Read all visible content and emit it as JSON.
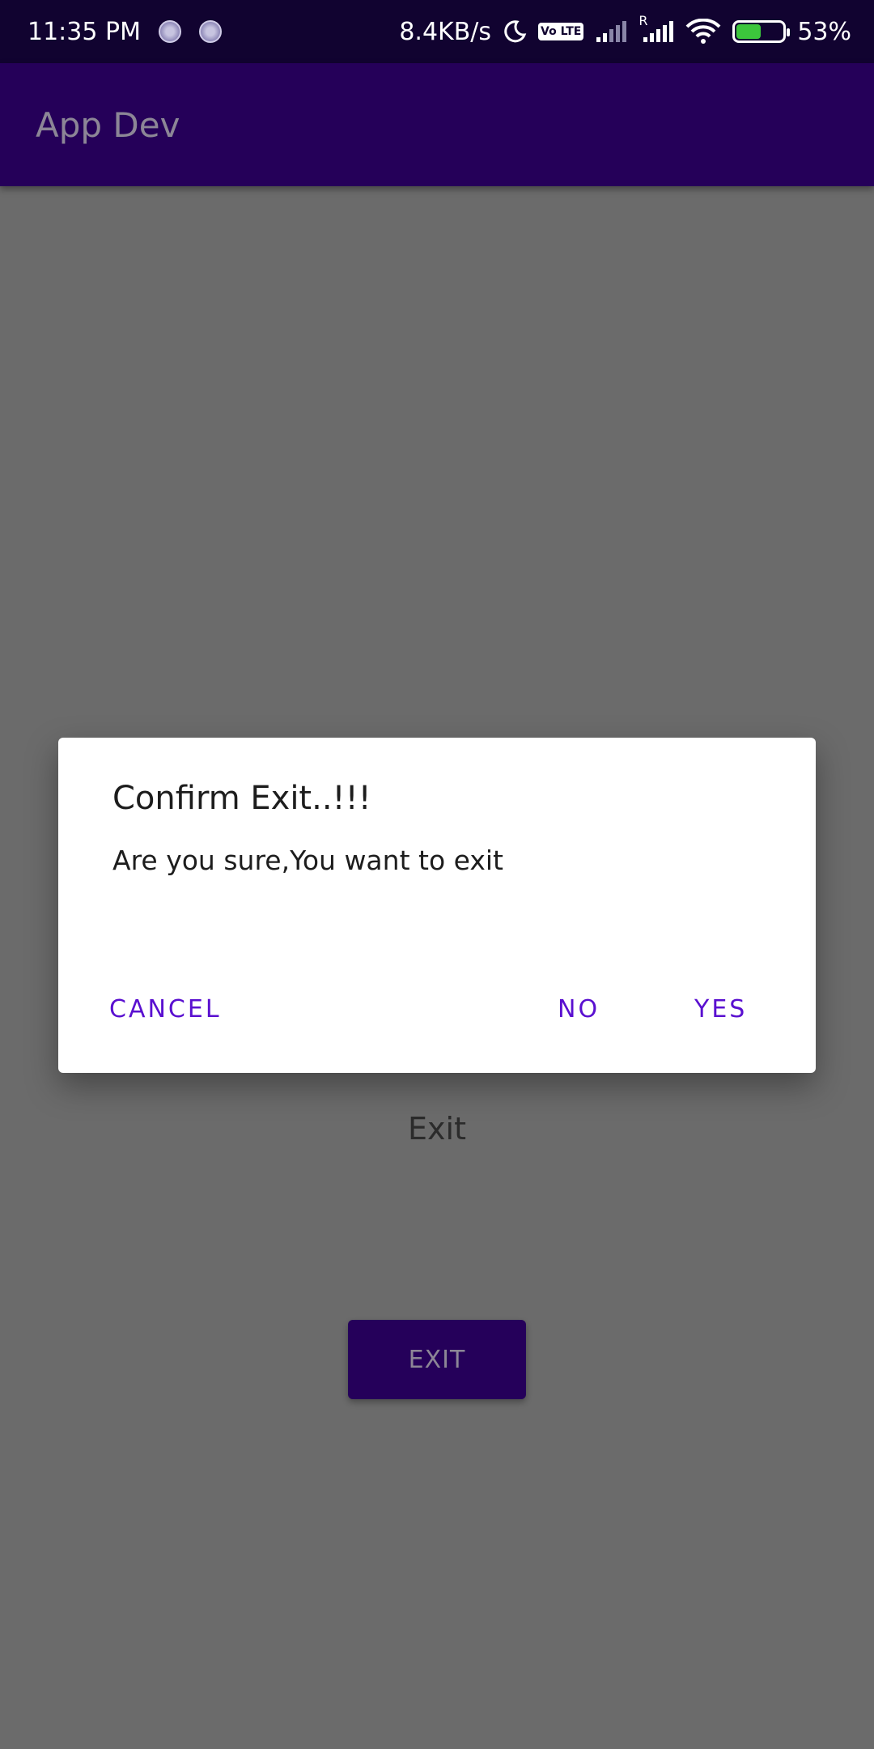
{
  "status_bar": {
    "time": "11:35 PM",
    "net_speed": "8.4KB/s",
    "volte": "Vo LTE",
    "roaming": "R",
    "battery": "53%",
    "icons": [
      "notification-dot-icon",
      "notification-dot-icon",
      "moon-icon",
      "volte-icon",
      "signal-icon",
      "signal-roaming-icon",
      "wifi-icon",
      "battery-charging-icon"
    ]
  },
  "app_bar": {
    "title": "App Dev"
  },
  "content": {
    "label": "Exit",
    "button_label": "EXIT"
  },
  "dialog": {
    "title": "Confirm Exit..!!!",
    "message": "Are you sure,You want to exit",
    "buttons": {
      "cancel": "CANCEL",
      "no": "NO",
      "yes": "YES"
    }
  },
  "colors": {
    "status_bar": "#110330",
    "app_bar": "#250059",
    "scrim_background": "#6b6b6b",
    "accent": "#5a10d0",
    "battery_fill": "#3cc63c"
  }
}
